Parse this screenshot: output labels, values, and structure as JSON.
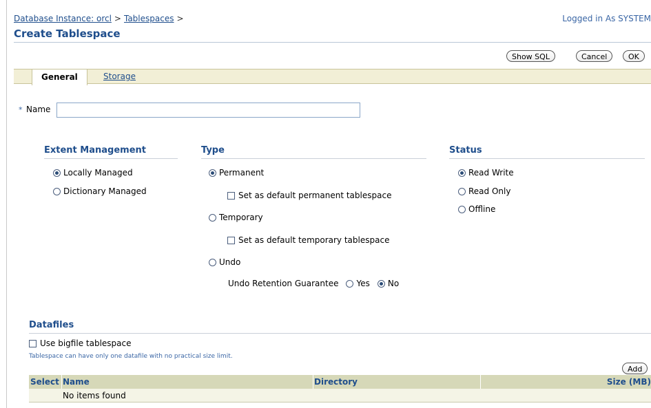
{
  "breadcrumb": {
    "instance": "Database Instance: orcl",
    "sep1": ">",
    "tablespaces": "Tablespaces",
    "sep2": ">"
  },
  "session": {
    "logged_in": "Logged in As SYSTEM"
  },
  "page": {
    "title": "Create Tablespace"
  },
  "toolbar": {
    "show_sql": "Show SQL",
    "cancel": "Cancel",
    "ok": "OK"
  },
  "tabs": [
    {
      "label": "General",
      "active": true
    },
    {
      "label": "Storage",
      "active": false
    }
  ],
  "name_field": {
    "required_marker": "*",
    "label": "Name",
    "value": ""
  },
  "extent_management": {
    "heading": "Extent Management",
    "options": [
      {
        "label": "Locally Managed",
        "selected": true
      },
      {
        "label": "Dictionary Managed",
        "selected": false
      }
    ]
  },
  "type": {
    "heading": "Type",
    "permanent": "Permanent",
    "default_permanent": "Set as default permanent tablespace",
    "temporary": "Temporary",
    "default_temporary": "Set as default temporary tablespace",
    "undo": "Undo",
    "undo_retention_label": "Undo Retention Guarantee",
    "yes": "Yes",
    "no": "No",
    "selected": "Permanent",
    "undo_retention_selected": "No"
  },
  "status": {
    "heading": "Status",
    "options": [
      {
        "label": "Read Write",
        "selected": true
      },
      {
        "label": "Read Only",
        "selected": false
      },
      {
        "label": "Offline",
        "selected": false
      }
    ]
  },
  "datafiles": {
    "heading": "Datafiles",
    "bigfile_label": "Use bigfile tablespace",
    "bigfile_hint": "Tablespace can have only one datafile with no practical size limit.",
    "add_button": "Add",
    "columns": {
      "select": "Select",
      "name": "Name",
      "directory": "Directory",
      "size": "Size (MB)"
    },
    "empty_text": "No items found"
  },
  "colors": {
    "link": "#1f4e8c",
    "accent": "#3a66a5",
    "tab_bar": "#f2efd6",
    "table_header": "#d6d8b8"
  }
}
